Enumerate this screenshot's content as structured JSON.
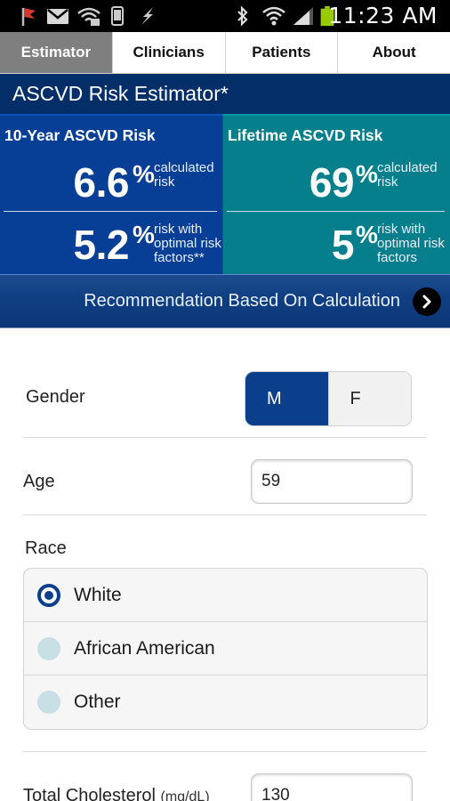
{
  "status_bar": {
    "time": "11:23 AM",
    "icons": [
      "flag-icon",
      "gmail-icon",
      "wifi-signal-icon",
      "phone-icon",
      "lightning-icon",
      "bluetooth-icon",
      "wifi-icon",
      "cell-signal-icon",
      "battery-icon"
    ]
  },
  "tabs": [
    {
      "label": "Estimator",
      "active": true
    },
    {
      "label": "Clinicians",
      "active": false
    },
    {
      "label": "Patients",
      "active": false
    },
    {
      "label": "About",
      "active": false
    }
  ],
  "header": {
    "title": "ASCVD Risk Estimator*"
  },
  "ten_year": {
    "title": "10-Year ASCVD Risk",
    "calculated_value": "6.6",
    "calculated_unit": "%",
    "calculated_label": "calculated risk",
    "optimal_value": "5.2",
    "optimal_unit": "%",
    "optimal_label": "risk with optimal risk factors**"
  },
  "lifetime": {
    "title": "Lifetime ASCVD Risk",
    "calculated_value": "69",
    "calculated_unit": "%",
    "calculated_label": "calculated risk",
    "optimal_value": "5",
    "optimal_unit": "%",
    "optimal_label": "risk with optimal risk factors"
  },
  "recommendation": {
    "label": "Recommendation Based On Calculation"
  },
  "form": {
    "gender": {
      "label": "Gender",
      "options": [
        "M",
        "F"
      ],
      "selected": "M"
    },
    "age": {
      "label": "Age",
      "value": "59"
    },
    "race": {
      "label": "Race",
      "options": [
        "White",
        "African American",
        "Other"
      ],
      "selected": "White"
    },
    "total_cholesterol": {
      "label": "Total Cholesterol",
      "unit": "(mg/dL)",
      "value": "130"
    }
  },
  "colors": {
    "ten_year_bg": "#073f96",
    "lifetime_bg": "#047f8b",
    "header_bg": "#032e68",
    "accent": "#0b3f8c"
  }
}
